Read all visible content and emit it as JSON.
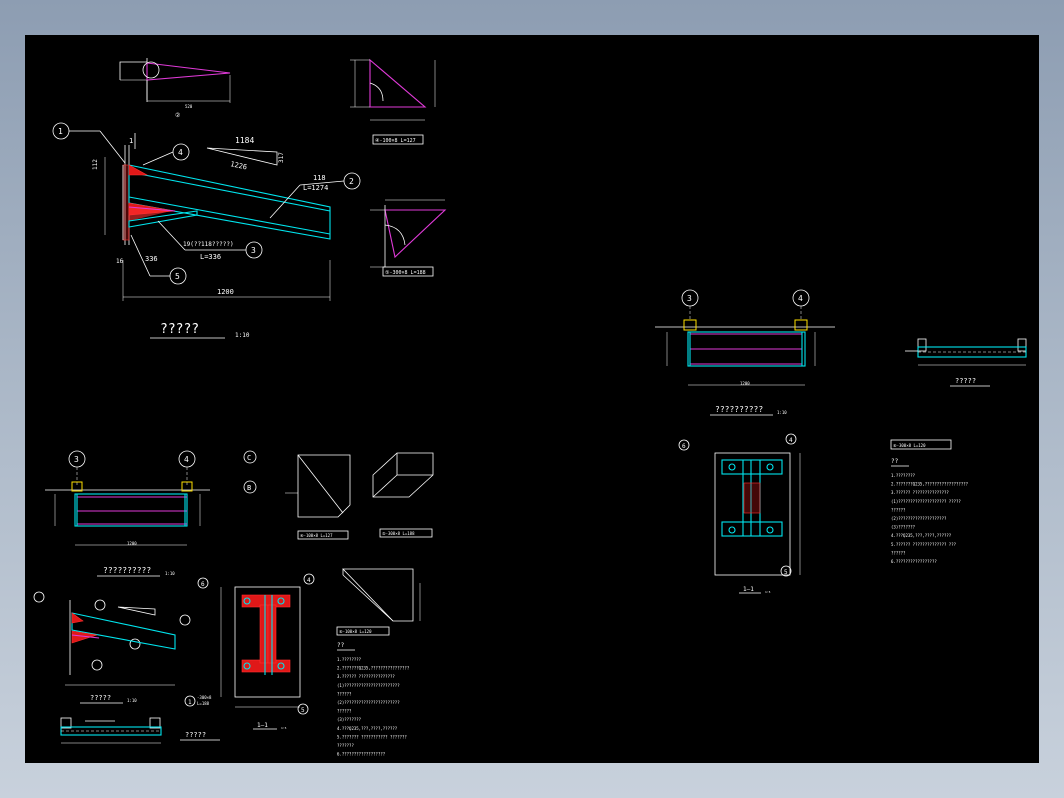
{
  "drawing": {
    "background": "#000000",
    "colors": {
      "line": "#ffffff",
      "steel": "#00e5ee",
      "weld": "#e03ad8",
      "plate": "#e01818",
      "bolt_box": "#ffe000"
    }
  },
  "left": {
    "detail2_label": "②",
    "detail4_label": "④-100×8 L=127",
    "detail5_label": "⑤-300×8 L=188",
    "main": {
      "dim_112": "112",
      "dim_1": "1",
      "dim_1184": "1184",
      "dim_1226": "1226",
      "dim_317": "317",
      "beam_18": "118",
      "beam_len": "L=1274",
      "sub_19": "19(??118?????)",
      "sub_len": "L=336",
      "dim_336": "336",
      "dim_16": "16",
      "dim_1200": "1200",
      "title": "?????",
      "scale": "1:10"
    },
    "callouts": {
      "c1": "1",
      "c2": "2",
      "c3": "3",
      "c4": "4",
      "c5": "5"
    },
    "elev": {
      "title": "??????????",
      "scale": "1:10",
      "c3": "3",
      "c4": "4",
      "dim_1200": "1200"
    },
    "small": {
      "C": "C",
      "B": "B",
      "d4": "④-100×8 L=127",
      "d5": "⑤-300×8 L=188",
      "d6": "⑥-100×8 L=120"
    },
    "iso_title": "?????",
    "iso_scale": "1:10",
    "plan_title": "?????",
    "section": {
      "label": "1—1",
      "scale": "1:5",
      "c1": "1",
      "c4": "4",
      "c5": "5",
      "c6": "6",
      "bolt_note": "-300×8",
      "bolt_len": "L=188"
    },
    "notes": {
      "heading": "??",
      "lines": [
        "1.????????",
        "2.???????Q235,????????????????",
        "3.?????? ???????????????",
        "(1)???????????????????????",
        "  ??????",
        "(2)???????????????????????",
        "  ??????",
        "(3)???????",
        "4.???Q235,???,????,??????",
        "5.??????? ??????????? ???????",
        "  ???????",
        "6.??????????????????"
      ]
    }
  },
  "right": {
    "elev": {
      "title": "??????????",
      "scale": "1:10",
      "c3": "3",
      "c4": "4",
      "dim_1200": "1200"
    },
    "plan_title": "?????",
    "section": {
      "label": "1—1",
      "scale": "1:5",
      "c4": "4",
      "c5": "5",
      "c6": "6"
    },
    "d6": "⑥-300×8 L=120",
    "notes": {
      "heading": "??",
      "lines": [
        "1.????????",
        "2.???????Q235,??????????????????",
        "3.?????? ???????????????",
        "(1)???????????????????? ?????",
        "  ??????",
        "(2)????????????????????",
        "(3)???????",
        "4.???Q235,???,????,??????",
        "5.?????? ?????????????? ???",
        "  ??????",
        "6.?????????????????"
      ]
    }
  }
}
